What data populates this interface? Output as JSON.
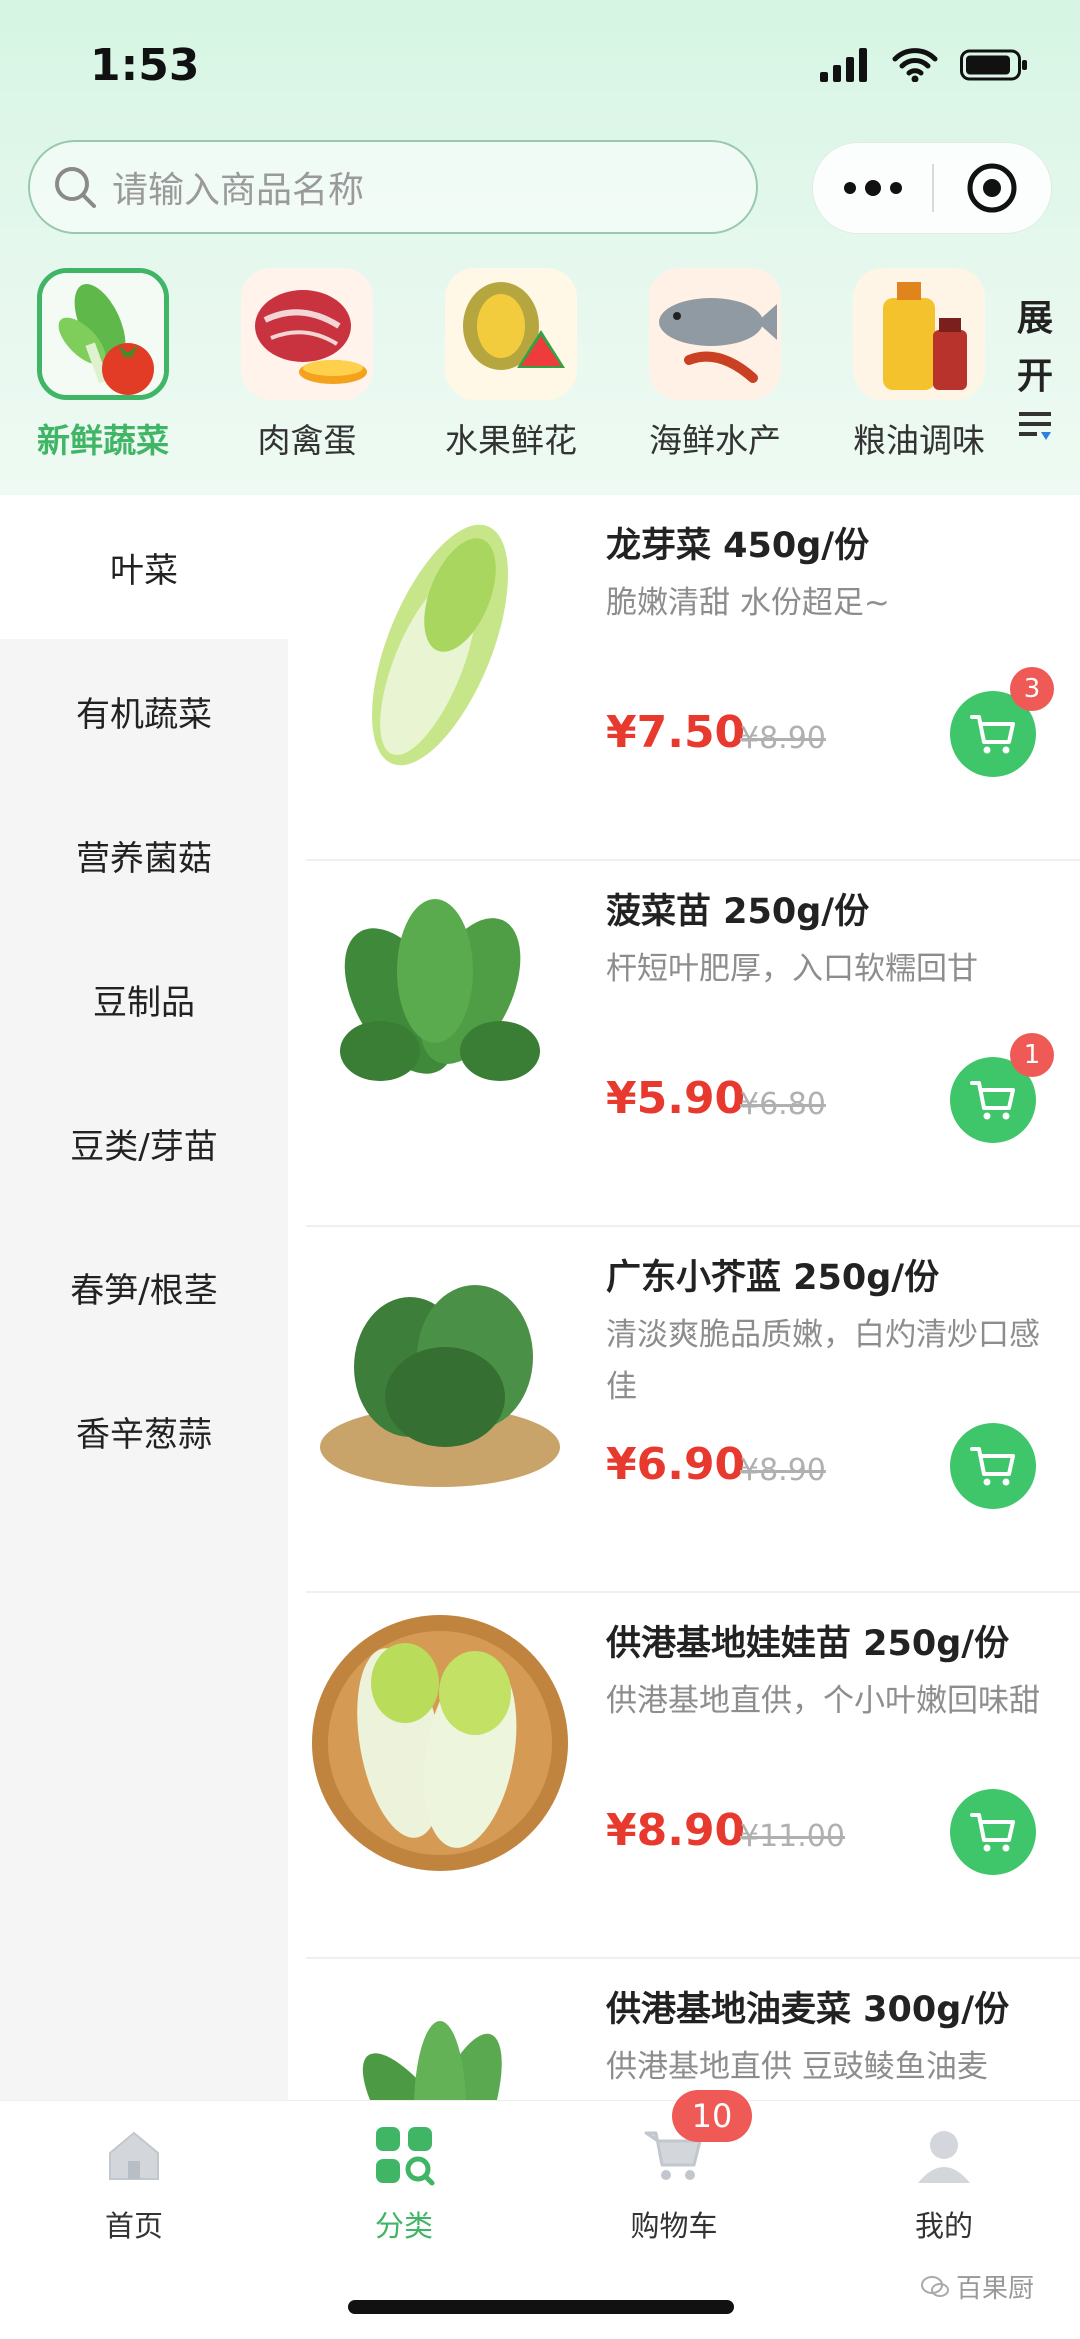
{
  "status_bar": {
    "time": "1:53"
  },
  "search": {
    "placeholder": "请输入商品名称"
  },
  "categories": [
    {
      "label": "新鲜蔬菜",
      "icon": "vegetables-image",
      "active": true
    },
    {
      "label": "肉禽蛋",
      "icon": "meat-image"
    },
    {
      "label": "水果鲜花",
      "icon": "fruit-image"
    },
    {
      "label": "海鲜水产",
      "icon": "seafood-image"
    },
    {
      "label": "粮油调味",
      "icon": "grain-oil-image"
    }
  ],
  "expand_label": [
    "展",
    "开"
  ],
  "sidebar": {
    "items": [
      {
        "label": "叶菜",
        "active": true
      },
      {
        "label": "有机蔬菜"
      },
      {
        "label": "营养菌菇"
      },
      {
        "label": "豆制品"
      },
      {
        "label": "豆类/芽苗"
      },
      {
        "label": "春笋/根茎"
      },
      {
        "label": "香辛葱蒜"
      }
    ]
  },
  "products": [
    {
      "name": "龙芽菜 450g/份",
      "desc": "脆嫩清甜 水份超足~",
      "price": "¥7.50",
      "old_price": "¥8.90",
      "cart_count": "3",
      "image": "napa-cabbage-image"
    },
    {
      "name": "菠菜苗 250g/份",
      "desc": "杆短叶肥厚，入口软糯回甘",
      "price": "¥5.90",
      "old_price": "¥6.80",
      "cart_count": "1",
      "image": "spinach-image"
    },
    {
      "name": "广东小芥蓝 250g/份",
      "desc": "清淡爽脆品质嫩，白灼清炒口感佳",
      "price": "¥6.90",
      "old_price": "¥8.90",
      "image": "chinese-kale-image"
    },
    {
      "name": "供港基地娃娃苗 250g/份",
      "desc": "供港基地直供，个小叶嫩回味甜",
      "price": "¥8.90",
      "old_price": "¥11.00",
      "image": "baby-cabbage-image"
    },
    {
      "name": "供港基地油麦菜 300g/份",
      "desc": "供港基地直供 豆豉鲮鱼油麦",
      "image": "lettuce-image"
    }
  ],
  "tabbar": {
    "items": [
      {
        "label": "首页",
        "icon": "home-icon"
      },
      {
        "label": "分类",
        "icon": "category-icon",
        "active": true
      },
      {
        "label": "购物车",
        "icon": "cart-icon"
      },
      {
        "label": "我的",
        "icon": "profile-icon"
      }
    ],
    "cart_badge": "10"
  },
  "watermark": "百果厨",
  "colors": {
    "accent": "#3fb565",
    "price": "#e8392f",
    "badge": "#ef5a56"
  }
}
